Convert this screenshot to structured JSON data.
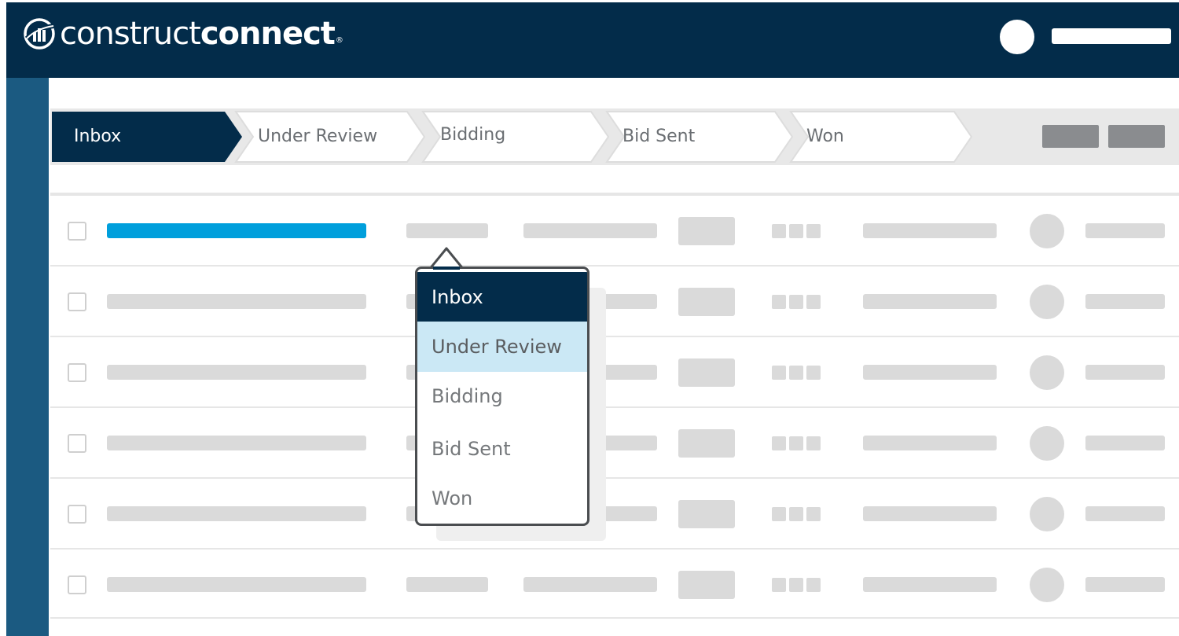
{
  "brand": {
    "name_light": "construct",
    "name_bold": "connect",
    "trademark": "®"
  },
  "pipeline": {
    "stages": [
      "Inbox",
      "Under Review",
      "Bidding",
      "Bid Sent",
      "Won"
    ],
    "active_index": 0
  },
  "status_menu": {
    "options": [
      "Inbox",
      "Under Review",
      "Bidding",
      "Bid Sent",
      "Won"
    ],
    "selected": "Inbox",
    "highlighted": "Under Review"
  },
  "rows": {
    "count": 6,
    "highlighted_row": 0
  },
  "colors": {
    "header_bg": "#032c4a",
    "rail_bg": "#1b5a81",
    "highlight_bar": "#009fdc",
    "menu_hover": "#cbe8f5",
    "placeholder": "#dadada"
  },
  "icons": [
    "logo-icon",
    "user-avatar",
    "checkbox",
    "dropdown-pointer"
  ]
}
